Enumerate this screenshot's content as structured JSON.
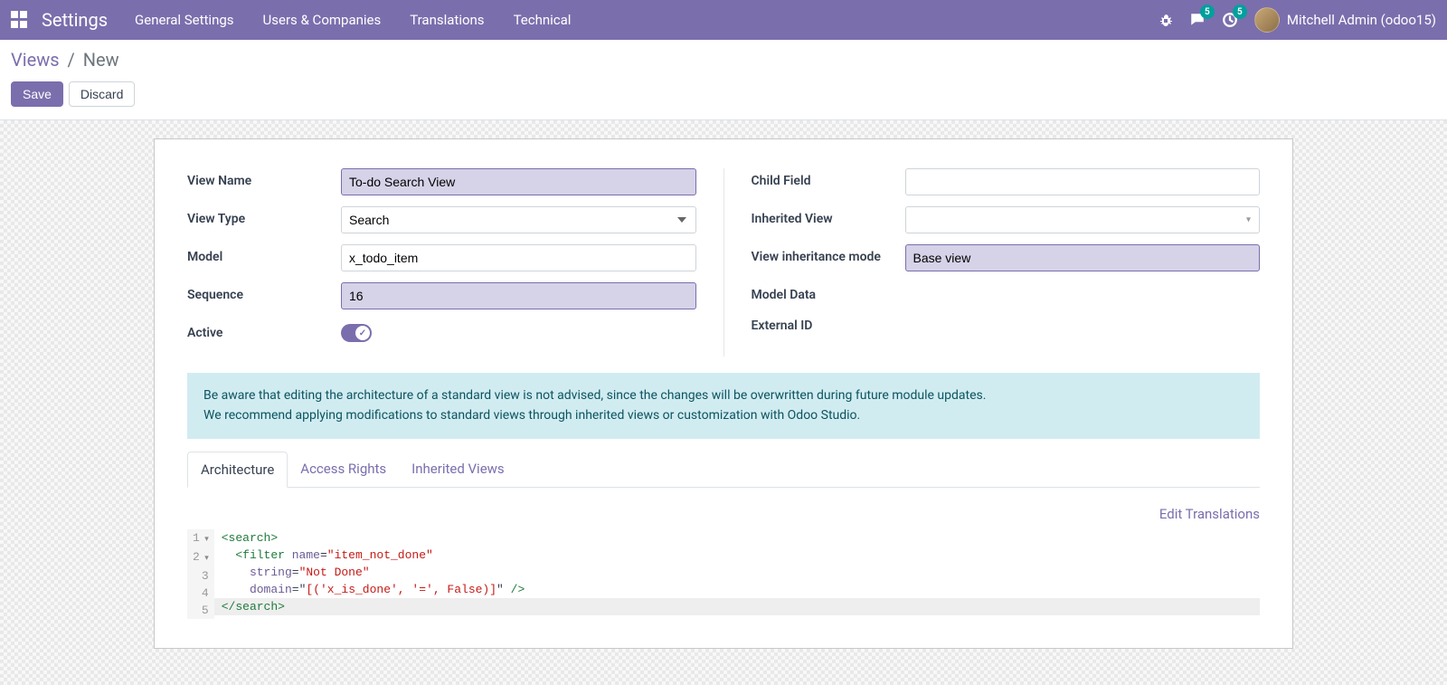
{
  "nav": {
    "app_title": "Settings",
    "menu": [
      "General Settings",
      "Users & Companies",
      "Translations",
      "Technical"
    ],
    "messages_badge": "5",
    "activities_badge": "5",
    "user": "Mitchell Admin (odoo15)"
  },
  "breadcrumb": {
    "parent": "Views",
    "current": "New"
  },
  "buttons": {
    "save": "Save",
    "discard": "Discard"
  },
  "form": {
    "left": {
      "view_name_label": "View Name",
      "view_name_value": "To-do Search View",
      "view_type_label": "View Type",
      "view_type_value": "Search",
      "model_label": "Model",
      "model_value": "x_todo_item",
      "sequence_label": "Sequence",
      "sequence_value": "16",
      "active_label": "Active"
    },
    "right": {
      "child_field_label": "Child Field",
      "child_field_value": "",
      "inherited_view_label": "Inherited View",
      "inherited_view_value": "",
      "inheritance_mode_label": "View inheritance mode",
      "inheritance_mode_value": "Base view",
      "model_data_label": "Model Data",
      "external_id_label": "External ID"
    }
  },
  "warning": {
    "line1": "Be aware that editing the architecture of a standard view is not advised, since the changes will be overwritten during future module updates.",
    "line2": "We recommend applying modifications to standard views through inherited views or customization with Odoo Studio."
  },
  "tabs": {
    "architecture": "Architecture",
    "access_rights": "Access Rights",
    "inherited_views": "Inherited Views"
  },
  "edit_translations": "Edit Translations",
  "code": {
    "l1_a": "<search>",
    "l2_a": "  <filter ",
    "l2_attr": "name",
    "l2_eq": "=",
    "l2_val": "\"item_not_done\"",
    "l3_a": "    ",
    "l3_attr": "string",
    "l3_eq": "=",
    "l3_val": "\"Not Done\"",
    "l4_a": "    ",
    "l4_attr": "domain",
    "l4_eq": "=",
    "l4_q1": "\"",
    "l4_val": "[('x_is_done', '=', False)]",
    "l4_q2": "\"",
    "l4_close": " />",
    "l5_a": "</search>"
  }
}
